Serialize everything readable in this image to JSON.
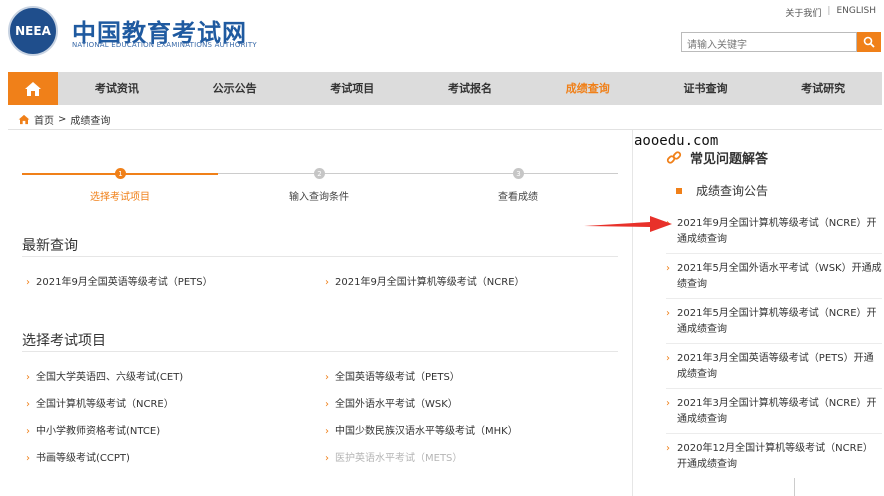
{
  "header": {
    "logo_text": "NEEA",
    "title": "中国教育考试网",
    "subtitle": "NATIONAL EDUCATION EXAMINATIONS AUTHORITY",
    "top_links": [
      "关于我们",
      "ENGLISH"
    ],
    "search_placeholder": "请输入关键字"
  },
  "nav": {
    "items": [
      "考试资讯",
      "公示公告",
      "考试项目",
      "考试报名",
      "成绩查询",
      "证书查询",
      "考试研究"
    ],
    "active": "成绩查询"
  },
  "breadcrumb": {
    "home": "首页",
    "sep": ">",
    "current": "成绩查询"
  },
  "steps": [
    {
      "num": "1",
      "label": "选择考试项目",
      "state": "active"
    },
    {
      "num": "2",
      "label": "输入查询条件",
      "state": "todo"
    },
    {
      "num": "3",
      "label": "查看成绩",
      "state": "todo"
    }
  ],
  "latest": {
    "title": "最新查询",
    "items": [
      "2021年9月全国英语等级考试（PETS）",
      "2021年9月全国计算机等级考试（NCRE）"
    ]
  },
  "projects": {
    "title": "选择考试项目",
    "items": [
      {
        "label": "全国大学英语四、六级考试(CET)",
        "enabled": true
      },
      {
        "label": "全国英语等级考试（PETS）",
        "enabled": true
      },
      {
        "label": "全国计算机等级考试（NCRE）",
        "enabled": true
      },
      {
        "label": "全国外语水平考试（WSK）",
        "enabled": true
      },
      {
        "label": "中小学教师资格考试(NTCE)",
        "enabled": true
      },
      {
        "label": "中国少数民族汉语水平等级考试（MHK）",
        "enabled": true
      },
      {
        "label": "书画等级考试(CCPT)",
        "enabled": true
      },
      {
        "label": "医护英语水平考试（METS）",
        "enabled": false
      }
    ]
  },
  "sidebar": {
    "watermark": "aooedu.com",
    "faq_title": "常见问题解答",
    "notice_title": "成绩查询公告",
    "notices": [
      "2021年9月全国计算机等级考试（NCRE）开通成绩查询",
      "2021年5月全国外语水平考试（WSK）开通成绩查询",
      "2021年5月全国计算机等级考试（NCRE）开通成绩查询",
      "2021年3月全国英语等级考试（PETS）开通成绩查询",
      "2021年3月全国计算机等级考试（NCRE）开通成绩查询",
      "2020年12月全国计算机等级考试（NCRE）开通成绩查询"
    ]
  },
  "colors": {
    "accent": "#f08019",
    "brand": "#1f5aa0",
    "arrow": "#e8312a"
  },
  "icons": {
    "home": "home-icon",
    "search": "search-icon",
    "faq": "link-icon"
  }
}
